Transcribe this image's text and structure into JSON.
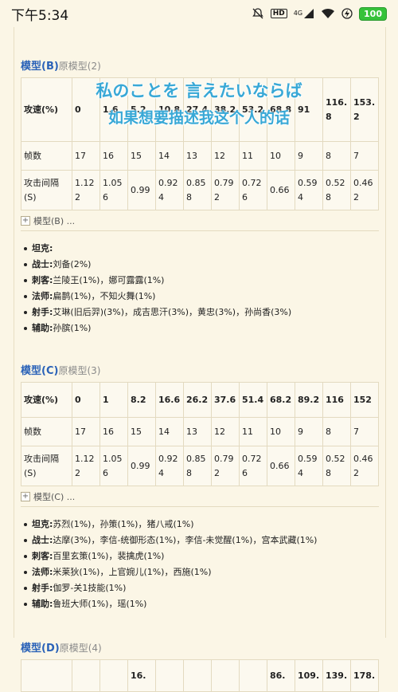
{
  "status_bar": {
    "time": "下午5:34",
    "network": "4G",
    "hd": "HD",
    "battery": "100"
  },
  "overlay": {
    "line1": "私のことを 言えたいならば",
    "line2": "如果想要描述我这个人的话"
  },
  "section_b": {
    "model": "模型(B)",
    "orig": "原模型(2)",
    "rows": [
      {
        "label": "攻速(%)",
        "cells": [
          "0",
          "1.6",
          "5.2",
          "10.8",
          "27.4",
          "38.2",
          "53.2",
          "68.8",
          "91",
          "116.8",
          "153.2"
        ]
      },
      {
        "label": "帧数",
        "cells": [
          "17",
          "16",
          "15",
          "14",
          "13",
          "12",
          "11",
          "10",
          "9",
          "8",
          "7"
        ]
      },
      {
        "label": "攻击间隔(S)",
        "cells": [
          "1.122",
          "1.056",
          "0.99",
          "0.924",
          "0.858",
          "0.792",
          "0.726",
          "0.66",
          "0.594",
          "0.528",
          "0.462"
        ]
      }
    ],
    "expander": "模型(B) ...",
    "roles": [
      {
        "role": "坦克:",
        "heroes": ""
      },
      {
        "role": "战士:",
        "heroes": "刘备(2%)"
      },
      {
        "role": "刺客:",
        "heroes": "兰陵王(1%)，娜可露露(1%)"
      },
      {
        "role": "法师:",
        "heroes": "扁鹊(1%)，不知火舞(1%)"
      },
      {
        "role": "射手:",
        "heroes": "艾琳(旧后羿)(3%)，成吉思汗(3%)，黄忠(3%)，孙尚香(3%)"
      },
      {
        "role": "辅助:",
        "heroes": "孙膑(1%)"
      }
    ]
  },
  "section_c": {
    "model": "模型(C)",
    "orig": "原模型(3)",
    "rows": [
      {
        "label": "攻速(%)",
        "cells": [
          "0",
          "1",
          "8.2",
          "16.6",
          "26.2",
          "37.6",
          "51.4",
          "68.2",
          "89.2",
          "116",
          "152"
        ]
      },
      {
        "label": "帧数",
        "cells": [
          "17",
          "16",
          "15",
          "14",
          "13",
          "12",
          "11",
          "10",
          "9",
          "8",
          "7"
        ]
      },
      {
        "label": "攻击间隔(S)",
        "cells": [
          "1.122",
          "1.056",
          "0.99",
          "0.924",
          "0.858",
          "0.792",
          "0.726",
          "0.66",
          "0.594",
          "0.528",
          "0.462"
        ]
      }
    ],
    "expander": "模型(C) ...",
    "roles": [
      {
        "role": "坦克:",
        "heroes": "苏烈(1%)，孙策(1%)，猪八戒(1%)"
      },
      {
        "role": "战士:",
        "heroes": "达摩(3%)，李信-统御形态(1%)，李信-未觉醒(1%)，宫本武藏(1%)"
      },
      {
        "role": "刺客:",
        "heroes": "百里玄策(1%)，裴擒虎(1%)"
      },
      {
        "role": "法师:",
        "heroes": "米莱狄(1%)，上官婉儿(1%)，西施(1%)"
      },
      {
        "role": "射手:",
        "heroes": "伽罗-关1技能(1%)"
      },
      {
        "role": "辅助:",
        "heroes": "鲁班大师(1%)，瑶(1%)"
      }
    ]
  },
  "section_d": {
    "model": "模型(D)",
    "orig": "原模型(4)",
    "row1": [
      "",
      "",
      "",
      "16.",
      "",
      "",
      "",
      "",
      "86.",
      "109.",
      "139.",
      "178."
    ]
  }
}
